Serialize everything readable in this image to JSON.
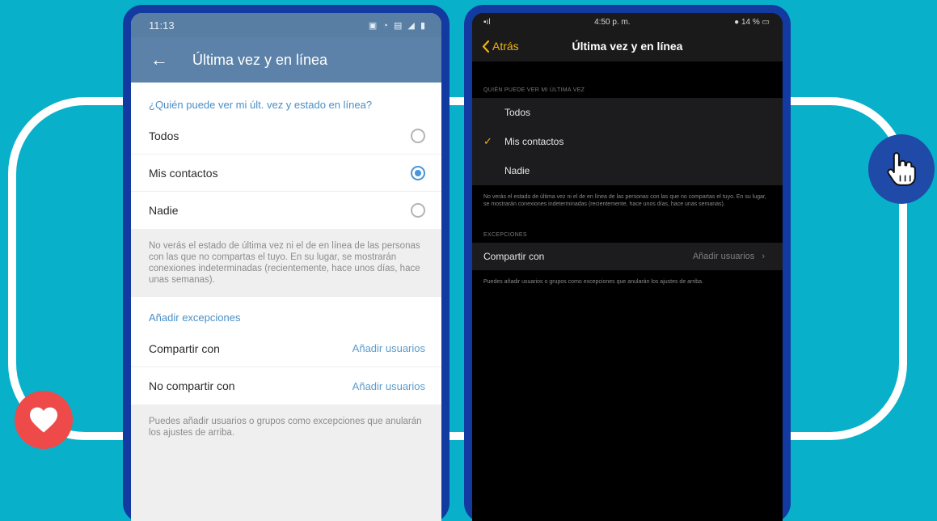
{
  "colors": {
    "background": "#08b0c9",
    "android_accent": "#4a95d6",
    "ios_accent": "#f0b215",
    "heart": "#ef4a4a",
    "hand_badge": "#1f4aa8"
  },
  "decor": {
    "heart_icon": "heart-icon",
    "hand_icon": "pointer-hand-icon"
  },
  "android": {
    "status": {
      "time": "11:13",
      "icons": "▣ ◔ ▤ ◢ ▮"
    },
    "toolbar": {
      "back": "←",
      "title": "Última vez y en línea"
    },
    "section_header": "¿Quién puede ver mi últ. vez y estado en línea?",
    "options": [
      {
        "label": "Todos",
        "selected": false
      },
      {
        "label": "Mis contactos",
        "selected": true
      },
      {
        "label": "Nadie",
        "selected": false
      }
    ],
    "note": "No verás el estado de última vez ni el de en línea de las personas con las que no compartas el tuyo. En su lugar, se mostrarán conexiones indeterminadas (recientemente, hace unos días, hace unas semanas).",
    "exceptions_header": "Añadir excepciones",
    "exceptions": [
      {
        "label": "Compartir con",
        "value": "Añadir usuarios"
      },
      {
        "label": "No compartir con",
        "value": "Añadir usuarios"
      }
    ],
    "footer_note": "Puedes añadir usuarios o grupos como excepciones que anularán los ajustes de arriba."
  },
  "ios": {
    "status": {
      "signal": "▪ıl",
      "time": "4:50 p. m.",
      "battery": "● 14 % ▭"
    },
    "nav": {
      "back": "Atrás",
      "title": "Última vez y en línea"
    },
    "section_header": "QUIÉN PUEDE VER MI ÚLTIMA VEZ",
    "options": [
      {
        "label": "Todos",
        "checked": false
      },
      {
        "label": "Mis contactos",
        "checked": true
      },
      {
        "label": "Nadie",
        "checked": false
      }
    ],
    "check_mark": "✓",
    "note": "No verás el estado de última vez ni el de en línea de las personas con las que no compartas el tuyo. En su lugar, se mostrarán conexiones indeterminadas (recientemente, hace unos días, hace unas semanas).",
    "exceptions_header": "EXCEPCIONES",
    "share": {
      "label": "Compartir con",
      "value": "Añadir usuarios",
      "chevron": "›"
    },
    "footer_note": "Puedes añadir usuarios o grupos como excepciones que anularán los ajustes de arriba."
  }
}
